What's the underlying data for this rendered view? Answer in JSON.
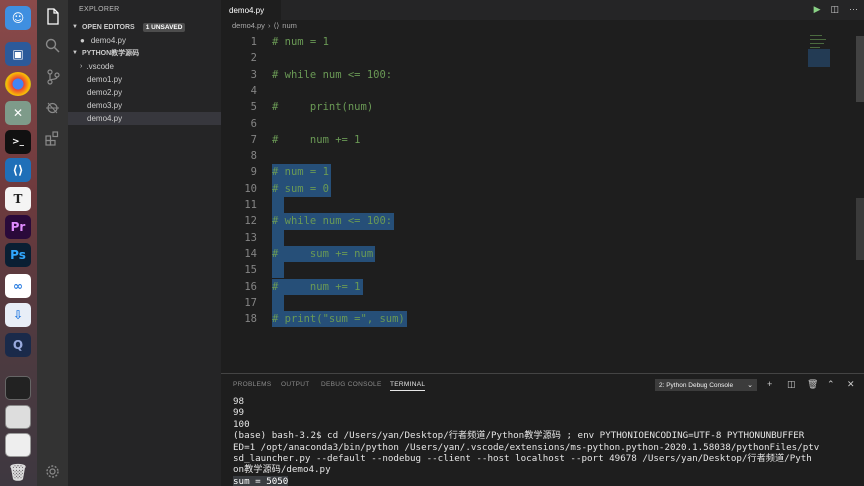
{
  "explorer": {
    "title": "EXPLORER",
    "open_editors": {
      "label": "OPEN EDITORS",
      "badge": "1 UNSAVED",
      "items": [
        "demo4.py"
      ]
    },
    "project": {
      "label": "PYTHON教学源码",
      "items": [
        ".vscode",
        "demo1.py",
        "demo2.py",
        "demo3.py",
        "demo4.py"
      ]
    }
  },
  "tab": {
    "label": "demo4.py"
  },
  "breadcrumb": {
    "file": "demo4.py",
    "symbol": "num"
  },
  "code_lines": [
    {
      "n": "1",
      "text": "# num = 1"
    },
    {
      "n": "2",
      "text": ""
    },
    {
      "n": "3",
      "text": "# while num <= 100:"
    },
    {
      "n": "4",
      "text": ""
    },
    {
      "n": "5",
      "text": "#     print(num)"
    },
    {
      "n": "6",
      "text": ""
    },
    {
      "n": "7",
      "text": "#     num += 1"
    },
    {
      "n": "8",
      "text": ""
    },
    {
      "n": "9",
      "text": "# num = 1"
    },
    {
      "n": "10",
      "text": "# sum = 0"
    },
    {
      "n": "11",
      "text": ""
    },
    {
      "n": "12",
      "text": "# while num <= 100:"
    },
    {
      "n": "13",
      "text": ""
    },
    {
      "n": "14",
      "text": "#     sum += num"
    },
    {
      "n": "15",
      "text": ""
    },
    {
      "n": "16",
      "text": "#     num += 1"
    },
    {
      "n": "17",
      "text": ""
    },
    {
      "n": "18",
      "text": "# print(\"sum =\", sum)"
    }
  ],
  "panel": {
    "tabs": [
      "PROBLEMS",
      "OUTPUT",
      "DEBUG CONSOLE",
      "TERMINAL"
    ],
    "active_tab": "TERMINAL",
    "terminal_select": "2: Python Debug Console",
    "terminal_lines": [
      "98",
      "99",
      "100",
      "(base) bash-3.2$ cd /Users/yan/Desktop/行者频道/Python教学源码 ; env PYTHONIOENCODING=UTF-8 PYTHONUNBUFFER",
      "ED=1 /opt/anaconda3/bin/python /Users/yan/.vscode/extensions/ms-python.python-2020.1.58038/pythonFiles/ptv",
      "sd_launcher.py --default --nodebug --client --host localhost --port 49678 /Users/yan/Desktop/行者频道/Pyth",
      "on教学源码/demo4.py"
    ],
    "terminal_result": "sum = 5050"
  },
  "colors": {
    "comment": "#6a9955",
    "selection": "#264f78",
    "editor_bg": "#1e1e1e",
    "sidebar_bg": "#252526"
  }
}
